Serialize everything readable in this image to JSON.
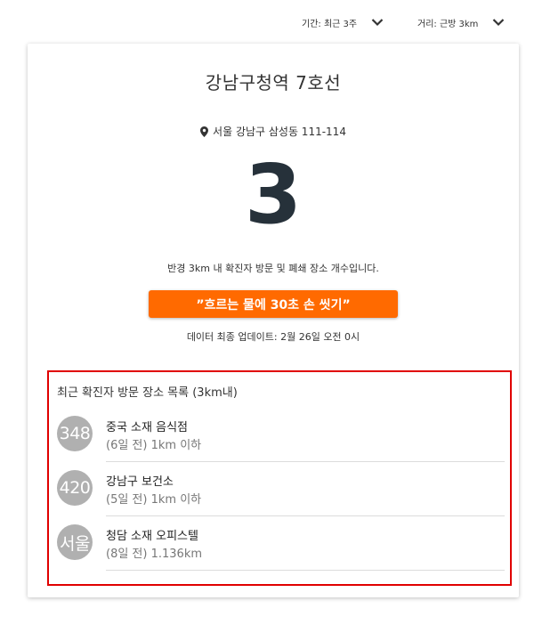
{
  "filters": {
    "period": {
      "label": "기간: 최근 3주",
      "icon": "chevron-down-icon"
    },
    "distance": {
      "label": "거리: 근방 3km",
      "icon": "chevron-down-icon"
    }
  },
  "station": {
    "name": "강남구청역 7호선",
    "address": "서울 강남구 삼성동 111-114",
    "address_icon": "location-pin-icon"
  },
  "count": "3",
  "description": "반경 3km 내 확진자 방문 및 폐쇄 장소 개수입니다.",
  "cta_label": "”흐르는 물에 30초 손 씻기”",
  "updated": "데이터 최종 업데이트: 2월 26일 오전 0시",
  "list": {
    "title": "최근 확진자 방문 장소 목록 (3km내)",
    "items": [
      {
        "badge": "348",
        "name": "중국 소재 음식점",
        "meta": "(6일 전) 1km 이하"
      },
      {
        "badge": "420",
        "name": "강남구 보건소",
        "meta": "(5일 전) 1km 이하"
      },
      {
        "badge": "서울",
        "name": "청담 소재 오피스텔",
        "meta": "(8일 전) 1.136km"
      }
    ]
  },
  "colors": {
    "accent": "#ff6a00",
    "count": "#26313a",
    "highlight_border": "#e00000",
    "badge": "#b0b0b0"
  }
}
